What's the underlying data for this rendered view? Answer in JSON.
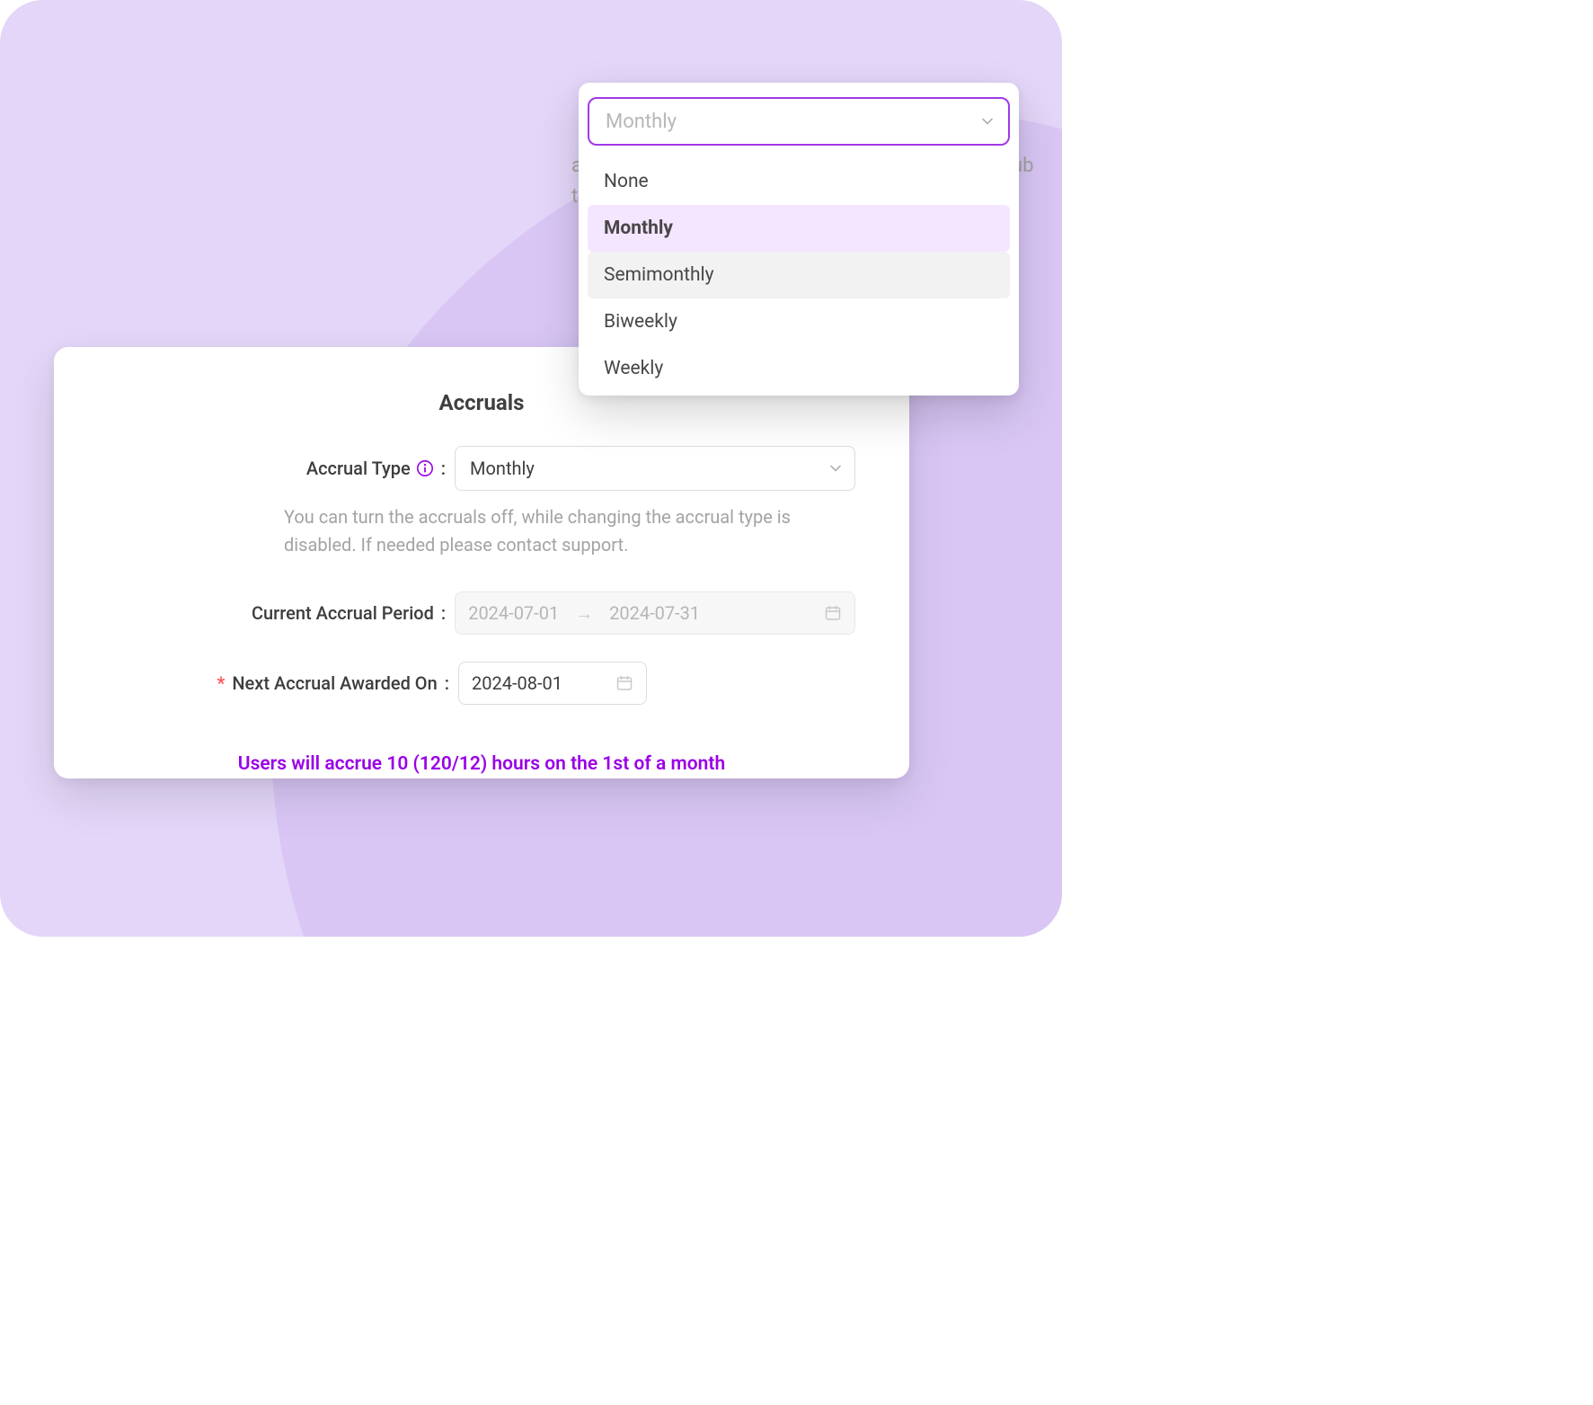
{
  "dropdown": {
    "placeholder": "Monthly",
    "options": [
      "None",
      "Monthly",
      "Semimonthly",
      "Biweekly",
      "Weekly"
    ],
    "selected": "Monthly",
    "hovered": "Semimonthly"
  },
  "peek_text": {
    "left": "a",
    "right": "ub",
    "below": "t"
  },
  "card": {
    "title": "Accruals",
    "accrual_type": {
      "label": "Accrual Type",
      "value": "Monthly"
    },
    "helper": "You can turn the accruals off, while changing the accrual type is disabled. If needed please contact support.",
    "current_period": {
      "label": "Current Accrual Period",
      "start": "2024-07-01",
      "end": "2024-07-31"
    },
    "next_award": {
      "label": "Next Accrual Awarded On",
      "required": true,
      "value": "2024-08-01"
    },
    "summary": "Users will accrue 10 (120/12) hours on the 1st of a month"
  }
}
